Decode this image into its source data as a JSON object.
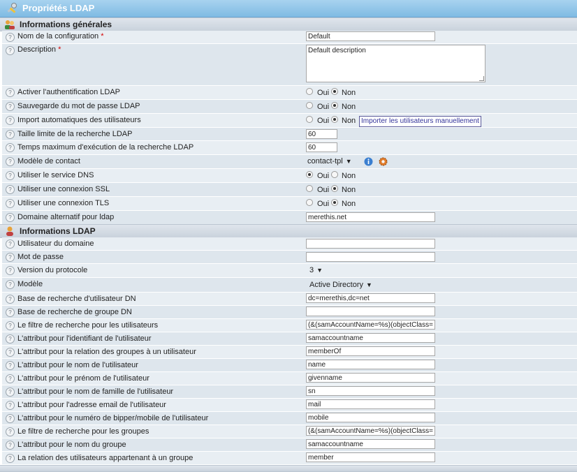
{
  "window": {
    "title": "Propriétés LDAP",
    "icon": "tools-icon"
  },
  "sections": {
    "general": {
      "title": "Informations générales",
      "icon": "users-icon"
    },
    "ldap": {
      "title": "Informations LDAP",
      "icon": "user-icon"
    }
  },
  "radio": {
    "yes": "Oui",
    "no": "Non"
  },
  "general": {
    "config_name": {
      "label": "Nom de la configuration",
      "required": "*",
      "value": "Default"
    },
    "description": {
      "label": "Description",
      "required": "*",
      "value": "Default description"
    },
    "ldap_auth": {
      "label": "Activer l'authentification LDAP",
      "selected": "Non"
    },
    "ldap_password_save": {
      "label": "Sauvegarde du mot de passe LDAP",
      "selected": "Non"
    },
    "auto_import": {
      "label": "Import automatiques des utilisateurs",
      "selected": "Non",
      "button": "Importer les utilisateurs manuellement"
    },
    "search_size_limit": {
      "label": "Taille limite de la recherche LDAP",
      "value": "60"
    },
    "search_timeout": {
      "label": "Temps maximum d'exécution de la recherche LDAP",
      "value": "60"
    },
    "contact_template": {
      "label": "Modèle de contact",
      "value": "contact-tpl",
      "arrow": "▼",
      "icons": [
        "info-icon",
        "gear-icon"
      ]
    },
    "dns_service": {
      "label": "Utiliser le service DNS",
      "selected": "Oui"
    },
    "ssl": {
      "label": "Utiliser une connexion SSL",
      "selected": "Non"
    },
    "tls": {
      "label": "Utiliser une connexion TLS",
      "selected": "Non"
    },
    "alt_domain": {
      "label": "Domaine alternatif pour ldap",
      "value": "merethis.net"
    }
  },
  "ldap": {
    "bind_user": {
      "label": "Utilisateur du domaine",
      "value": ""
    },
    "bind_password": {
      "label": "Mot de passe",
      "value": ""
    },
    "protocol_version": {
      "label": "Version du protocole",
      "value": "3",
      "arrow": "▼"
    },
    "template": {
      "label": "Modèle",
      "value": "Active Directory",
      "arrow": "▼"
    },
    "user_base_dn": {
      "label": "Base de recherche d'utilisateur DN",
      "value": "dc=merethis,dc=net"
    },
    "group_base_dn": {
      "label": "Base de recherche de groupe DN",
      "value": ""
    },
    "user_filter": {
      "label": "Le filtre de recherche pour les utilisateurs",
      "value": "(&(samAccountName=%s)(objectClass="
    },
    "attr_user_id": {
      "label": "L'attribut pour l'identifiant de l'utilisateur",
      "value": "samaccountname"
    },
    "attr_user_group": {
      "label": "L'attribut pour la relation des groupes à un utilisateur",
      "value": "memberOf"
    },
    "attr_user_name": {
      "label": "L'attribut pour le nom de l'utilisateur",
      "value": "name"
    },
    "attr_user_firstname": {
      "label": "L'attribut pour le prénom de l'utilisateur",
      "value": "givenname"
    },
    "attr_user_lastname": {
      "label": "L'attribut pour le nom de famille de l'utilisateur",
      "value": "sn"
    },
    "attr_user_email": {
      "label": "L'attribut pour l'adresse email de l'utilisateur",
      "value": "mail"
    },
    "attr_user_pager": {
      "label": "L'attribut pour le numéro de bipper/mobile de l'utilisateur",
      "value": "mobile"
    },
    "group_filter": {
      "label": "Le filtre de recherche pour les groupes",
      "value": "(&(samAccountName=%s)(objectClass="
    },
    "attr_group_name": {
      "label": "L'attribut pour le nom du groupe",
      "value": "samaccountname"
    },
    "attr_group_member": {
      "label": "La relation des utilisateurs appartenant à un groupe",
      "value": "member"
    }
  },
  "colors": {
    "title_bar": "#8cc4e8",
    "row_even": "#e8eef3",
    "row_odd": "#dee6ed",
    "required": "#d40000",
    "link": "#333399"
  }
}
